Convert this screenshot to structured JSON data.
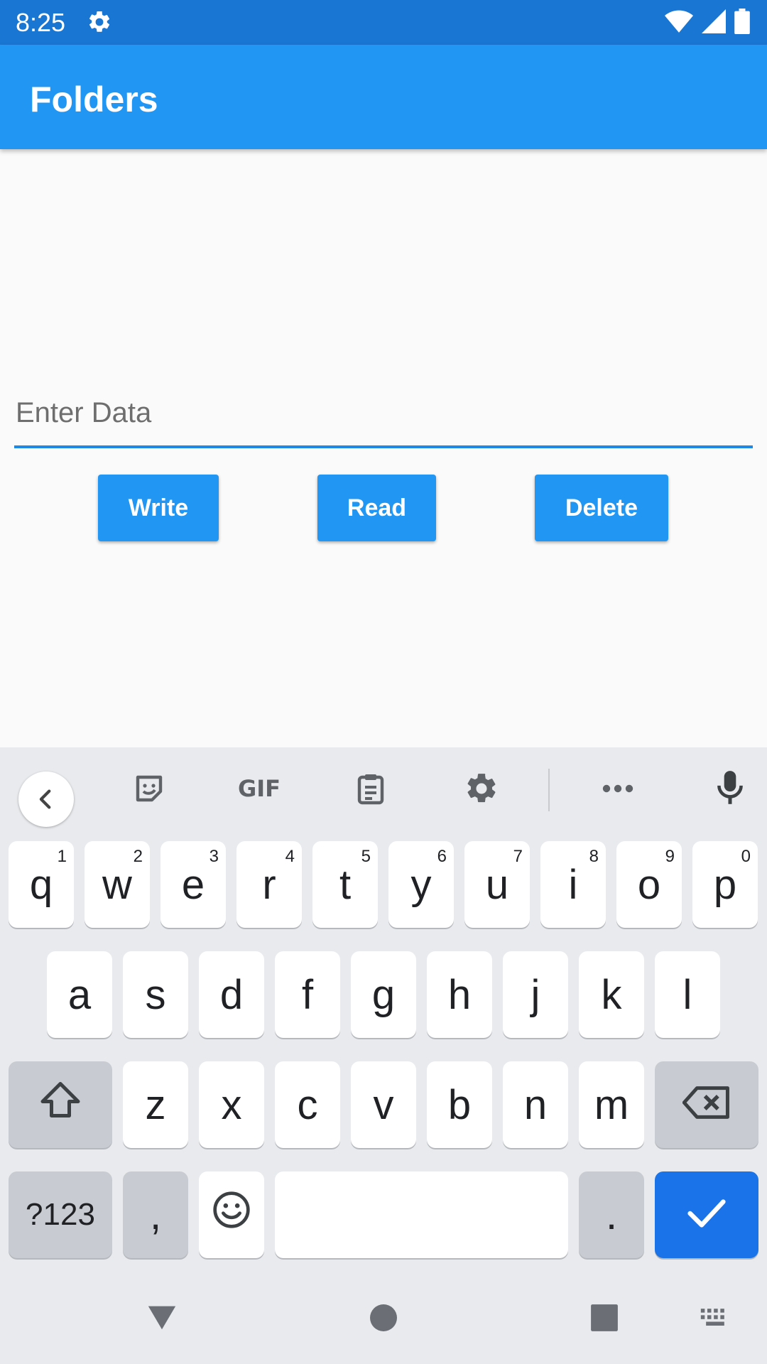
{
  "status_bar": {
    "time": "8:25",
    "icons": [
      "gear-icon",
      "wifi-icon",
      "signal-icon",
      "battery-icon"
    ],
    "color": "#1976d2"
  },
  "app_bar": {
    "title": "Folders",
    "color": "#2196f3"
  },
  "form": {
    "placeholder": "Enter Data",
    "value": "",
    "buttons": {
      "write": "Write",
      "read": "Read",
      "delete": "Delete"
    }
  },
  "keyboard": {
    "toolbar": [
      "back-chevron-icon",
      "sticker-icon",
      "gif-icon",
      "clipboard-icon",
      "gear-icon",
      "more-icon",
      "mic-icon"
    ],
    "gif_label": "GIF",
    "row1": [
      {
        "key": "q",
        "hint": "1"
      },
      {
        "key": "w",
        "hint": "2"
      },
      {
        "key": "e",
        "hint": "3"
      },
      {
        "key": "r",
        "hint": "4"
      },
      {
        "key": "t",
        "hint": "5"
      },
      {
        "key": "y",
        "hint": "6"
      },
      {
        "key": "u",
        "hint": "7"
      },
      {
        "key": "i",
        "hint": "8"
      },
      {
        "key": "o",
        "hint": "9"
      },
      {
        "key": "p",
        "hint": "0"
      }
    ],
    "row2": [
      "a",
      "s",
      "d",
      "f",
      "g",
      "h",
      "j",
      "k",
      "l"
    ],
    "row3": [
      "z",
      "x",
      "c",
      "v",
      "b",
      "n",
      "m"
    ],
    "symbols_label": "?123",
    "comma_label": ",",
    "period_label": ".",
    "accent_color": "#1a73e8"
  },
  "nav_bar": [
    "back-triangle-icon",
    "home-circle-icon",
    "recents-square-icon",
    "keyboard-switch-icon"
  ]
}
